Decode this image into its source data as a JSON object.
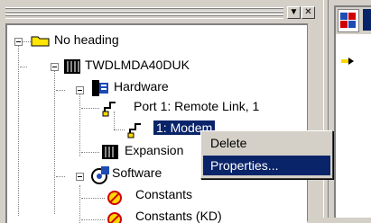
{
  "window": {
    "minimize_glyph": "▼",
    "close_glyph": "✕"
  },
  "tree": {
    "items": [
      {
        "label": "No heading"
      },
      {
        "label": "TWDLMDA40DUK"
      },
      {
        "label": "Hardware"
      },
      {
        "label": "Port 1: Remote Link, 1"
      },
      {
        "label": "1: Modem"
      },
      {
        "label": "Expansion"
      },
      {
        "label": "Software"
      },
      {
        "label": "Constants"
      },
      {
        "label": "Constants (KD)"
      }
    ]
  },
  "context_menu": {
    "items": [
      {
        "label": "Delete"
      },
      {
        "label": "Properties..."
      }
    ]
  },
  "colors": {
    "selection": "#0a246a",
    "background": "#d4d0c8"
  },
  "icons": [
    "folder-icon",
    "plc-icon",
    "hardware-icon",
    "port-icon",
    "modem-icon",
    "expansion-icon",
    "software-icon",
    "constants-icon"
  ]
}
